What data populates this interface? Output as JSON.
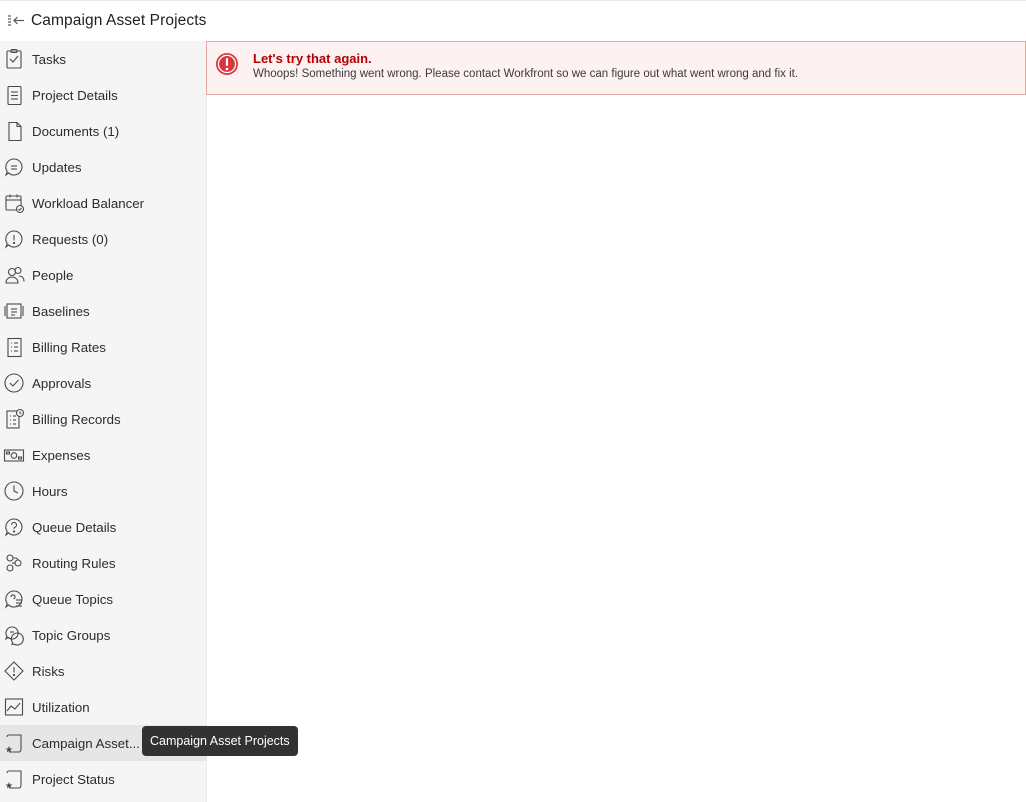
{
  "header": {
    "title": "Campaign Asset Projects"
  },
  "sidebar": {
    "items": [
      {
        "label": "Tasks",
        "icon": "tasks-icon"
      },
      {
        "label": "Project Details",
        "icon": "document-lines-icon"
      },
      {
        "label": "Documents (1)",
        "icon": "document-icon"
      },
      {
        "label": "Updates",
        "icon": "chat-bubble-icon"
      },
      {
        "label": "Workload Balancer",
        "icon": "calendar-check-icon"
      },
      {
        "label": "Requests (0)",
        "icon": "alert-bubble-icon"
      },
      {
        "label": "People",
        "icon": "people-icon"
      },
      {
        "label": "Baselines",
        "icon": "baseline-icon"
      },
      {
        "label": "Billing Rates",
        "icon": "billing-rates-icon"
      },
      {
        "label": "Approvals",
        "icon": "checkmark-circle-icon"
      },
      {
        "label": "Billing Records",
        "icon": "billing-records-icon"
      },
      {
        "label": "Expenses",
        "icon": "money-icon"
      },
      {
        "label": "Hours",
        "icon": "clock-icon"
      },
      {
        "label": "Queue Details",
        "icon": "queue-details-icon"
      },
      {
        "label": "Routing Rules",
        "icon": "routing-icon"
      },
      {
        "label": "Queue Topics",
        "icon": "queue-topics-icon"
      },
      {
        "label": "Topic Groups",
        "icon": "topic-groups-icon"
      },
      {
        "label": "Risks",
        "icon": "risk-diamond-icon"
      },
      {
        "label": "Utilization",
        "icon": "chart-line-icon"
      },
      {
        "label": "Campaign Asset...",
        "icon": "custom-page-star-icon"
      },
      {
        "label": "Project Status",
        "icon": "custom-page-star-icon"
      }
    ],
    "active_index": 19
  },
  "tooltip": {
    "text": "Campaign Asset Projects"
  },
  "alert": {
    "title": "Let's try that again.",
    "message": "Whoops! Something went wrong. Please contact Workfront so we can figure out what went wrong and fix it.",
    "color": "#d7373f"
  }
}
